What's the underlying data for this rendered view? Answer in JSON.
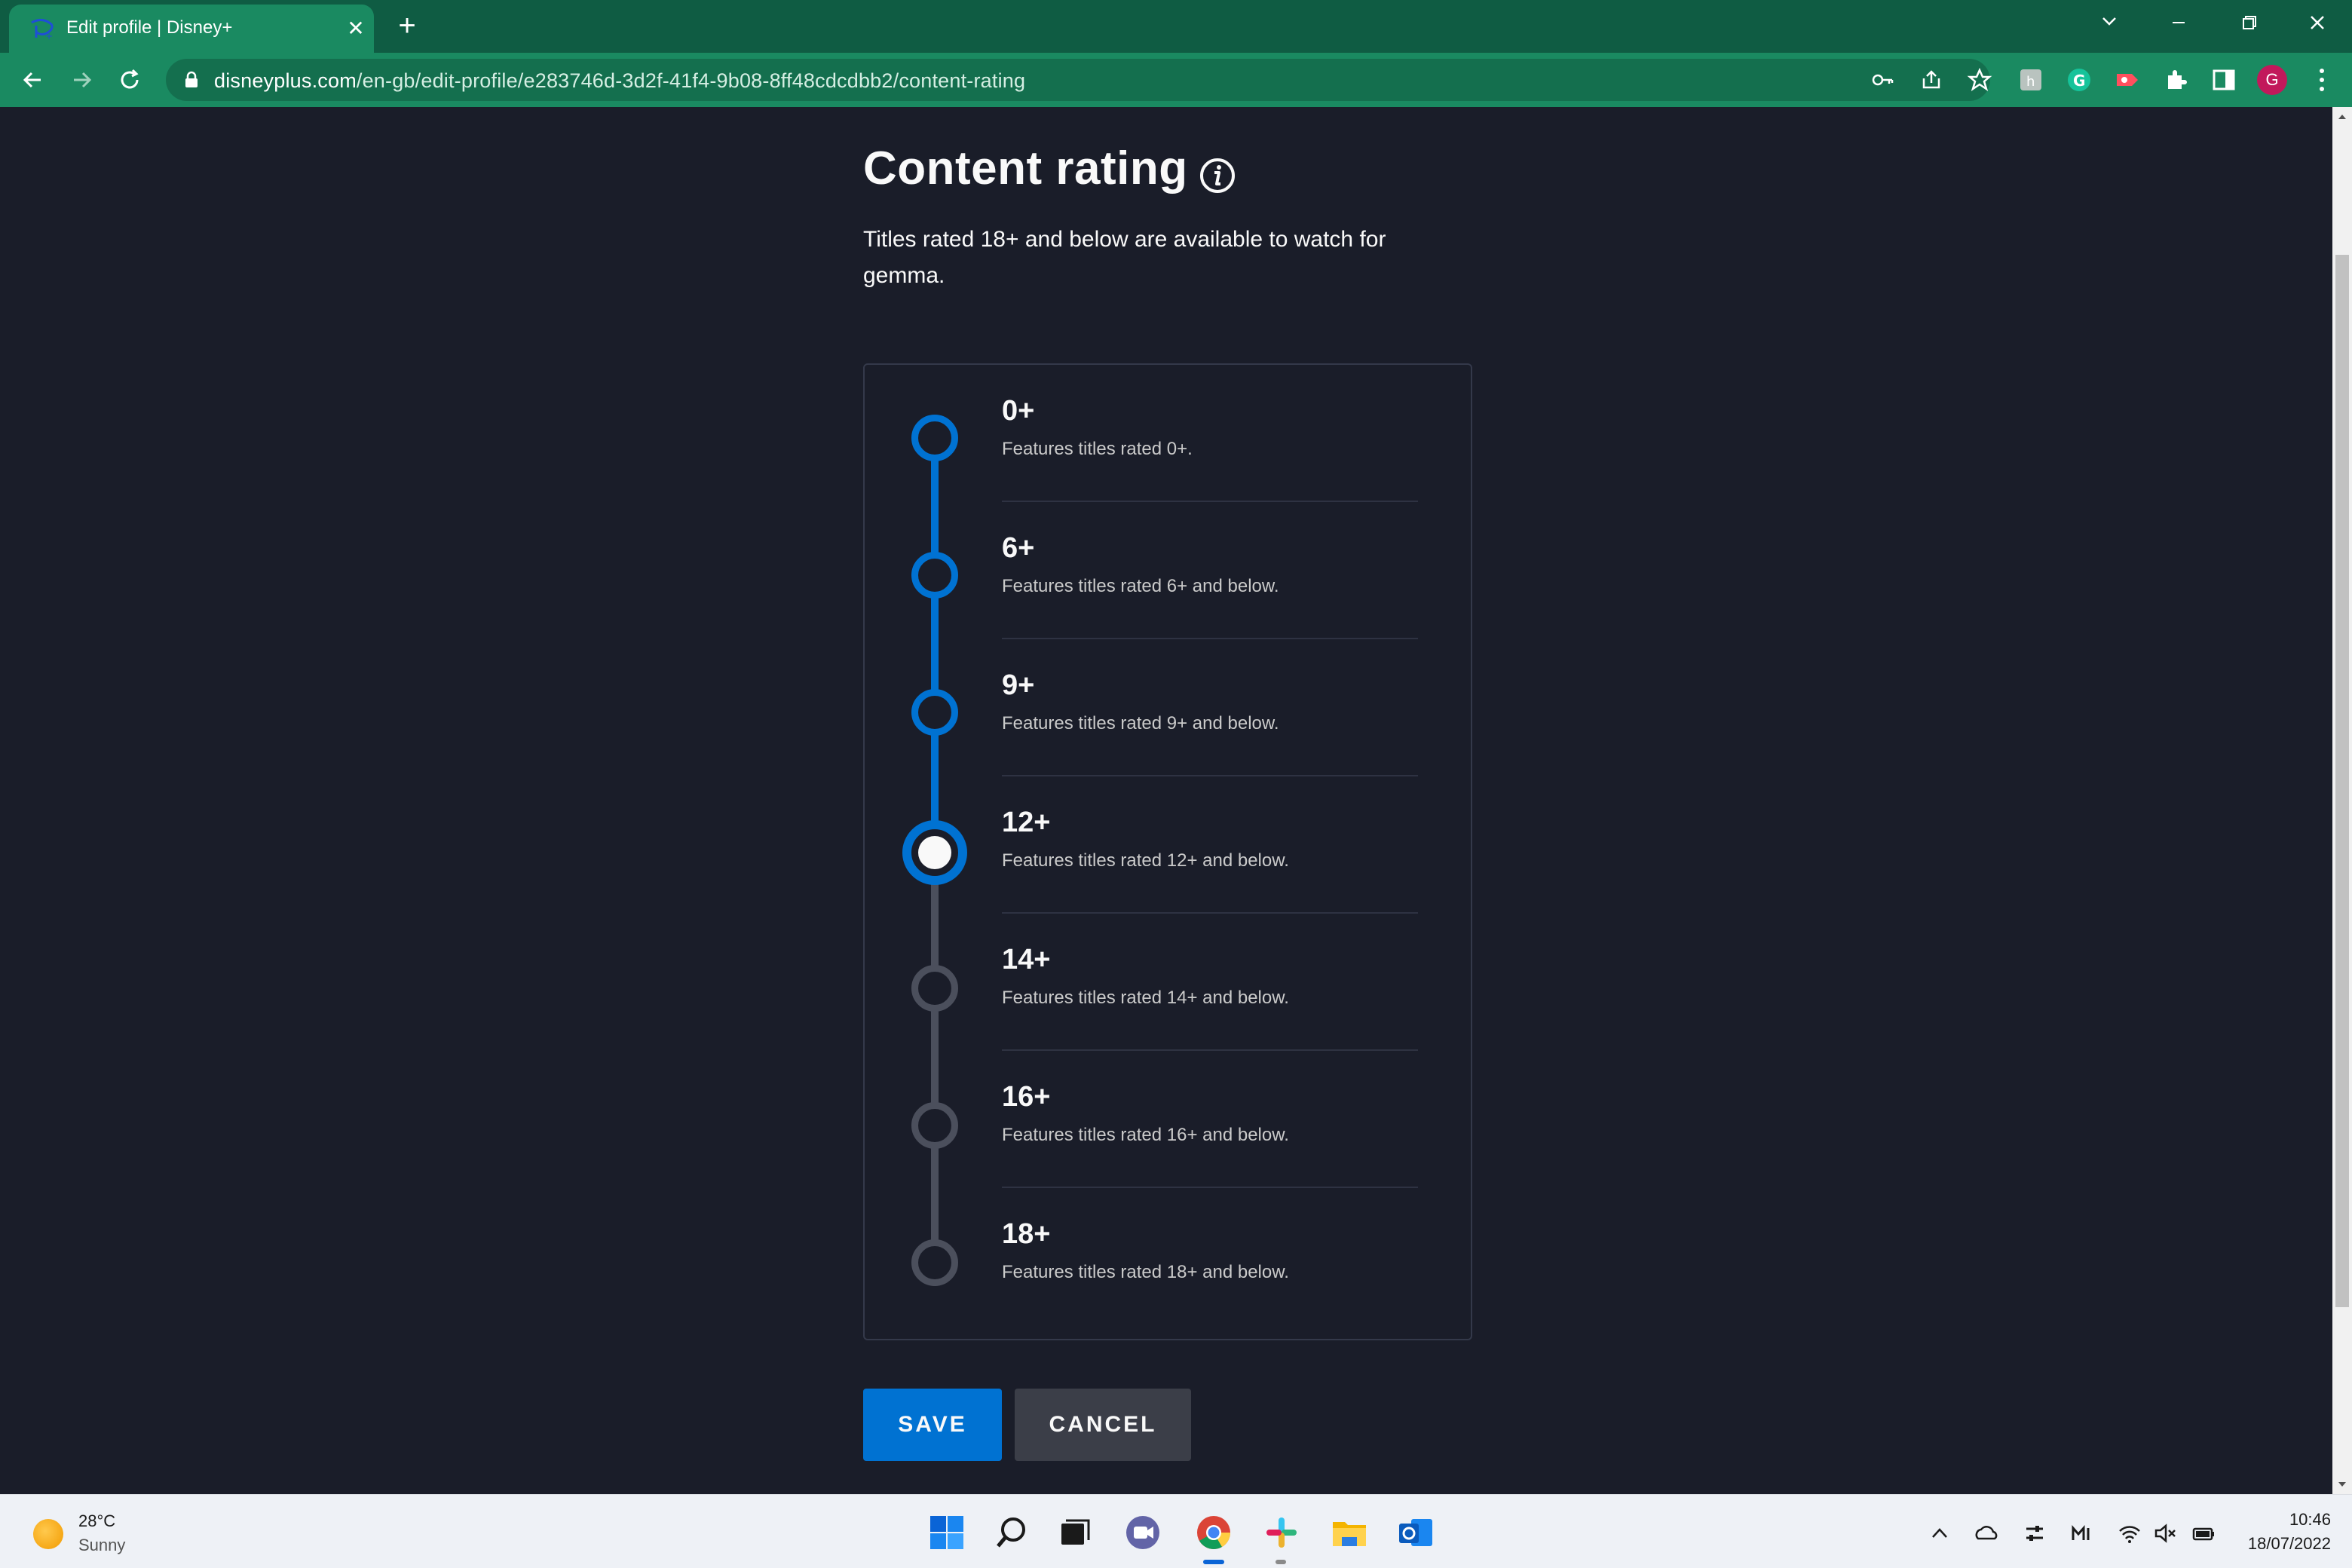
{
  "browser": {
    "tab_title": "Edit profile | Disney+",
    "url_host": "disneyplus.com",
    "url_path": "/en-gb/edit-profile/e283746d-3d2f-41f4-9b08-8ff48cdcdbb2/content-rating",
    "profile_initial": "G",
    "accent_colors": {
      "titlebar": "#0f5c43",
      "toolbar": "#1a8a61"
    }
  },
  "page": {
    "title": "Content rating",
    "subtitle": "Titles rated 18+ and below are available to watch for gemma.",
    "selected_rating": "12+",
    "options": [
      {
        "label": "0+",
        "description": "Features titles rated 0+.",
        "state": "active"
      },
      {
        "label": "6+",
        "description": "Features titles rated 6+ and below.",
        "state": "active"
      },
      {
        "label": "9+",
        "description": "Features titles rated 9+ and below.",
        "state": "active"
      },
      {
        "label": "12+",
        "description": "Features titles rated 12+ and below.",
        "state": "selected"
      },
      {
        "label": "14+",
        "description": "Features titles rated 14+ and below.",
        "state": "inactive"
      },
      {
        "label": "16+",
        "description": "Features titles rated 16+ and below.",
        "state": "inactive"
      },
      {
        "label": "18+",
        "description": "Features titles rated 18+ and below.",
        "state": "inactive"
      }
    ],
    "save_label": "SAVE",
    "cancel_label": "CANCEL",
    "colors": {
      "accent": "#0072d2",
      "background": "#1a1d29",
      "inactive": "#4b4f5c"
    }
  },
  "taskbar": {
    "weather_temp": "28°C",
    "weather_condition": "Sunny",
    "time": "10:46",
    "date": "18/07/2022"
  }
}
